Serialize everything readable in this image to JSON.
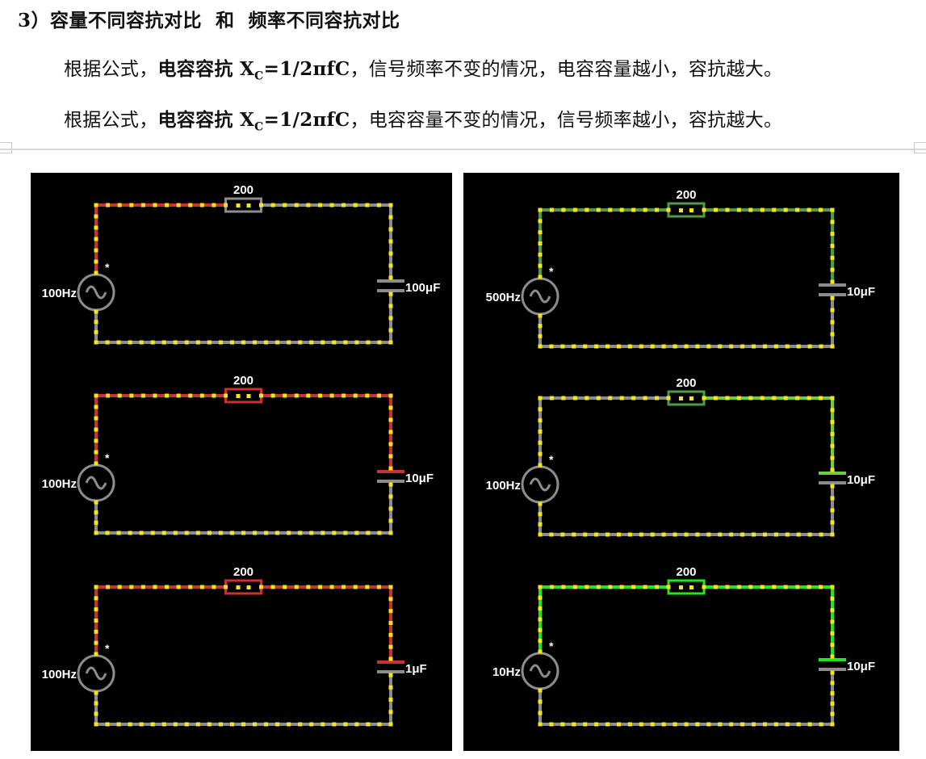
{
  "heading": "3）容量不同容抗对比  和  频率不同容抗对比",
  "formula_paragraphs": [
    {
      "prefix": "根据公式，",
      "bold_label": "电容容抗 ",
      "formula_x": "X",
      "formula_sub": "C",
      "formula_rest": "=1/2πfC",
      "suffix": "，信号频率不变的情况，电容容量越小，容抗越大。"
    },
    {
      "prefix": "根据公式，",
      "bold_label": "电容容抗 ",
      "formula_x": "X",
      "formula_sub": "C",
      "formula_rest": "=1/2πfC",
      "suffix": "，电容容量不变的情况，信号频率越小，容抗越大。"
    }
  ],
  "colors": {
    "wire_gray": "#8c8c8c",
    "red": "#c83232",
    "green_dim": "#4e9a45",
    "green_mid": "#6fcf3a",
    "green_bright": "#22e61b",
    "dot": "#f5e61b",
    "panel_bg": "#000000"
  },
  "left_panel": {
    "circuits": [
      {
        "resistor": "200",
        "source": "100Hz",
        "marker": "*",
        "capacitor": "100μF",
        "current_color": "red",
        "current_level": "low"
      },
      {
        "resistor": "200",
        "source": "100Hz",
        "marker": "*",
        "capacitor": "10μF",
        "current_color": "red",
        "current_level": "medium"
      },
      {
        "resistor": "200",
        "source": "100Hz",
        "marker": "*",
        "capacitor": "1μF",
        "current_color": "red",
        "current_level": "high"
      }
    ]
  },
  "right_panel": {
    "circuits": [
      {
        "resistor": "200",
        "source": "500Hz",
        "marker": "*",
        "capacitor": "10μF",
        "current_color": "green",
        "current_level": "low"
      },
      {
        "resistor": "200",
        "source": "100Hz",
        "marker": "*",
        "capacitor": "10μF",
        "current_color": "green",
        "current_level": "medium"
      },
      {
        "resistor": "200",
        "source": "10Hz",
        "marker": "*",
        "capacitor": "10μF",
        "current_color": "green",
        "current_level": "high"
      }
    ]
  }
}
